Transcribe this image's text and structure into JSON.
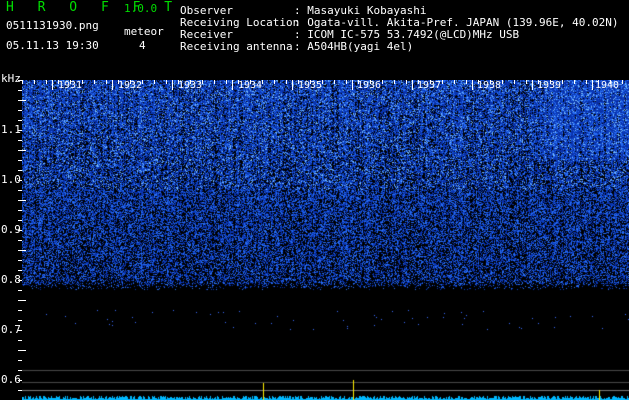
{
  "app": {
    "name": "H R O F F T",
    "version": "1.0.0"
  },
  "file": {
    "name": "0511131930.png",
    "datetime": "05.11.13 19:30"
  },
  "meteor": {
    "label": "meteor",
    "count": "4"
  },
  "station": {
    "observer": {
      "label": "Observer",
      "value": ": Masayuki Kobayashi"
    },
    "location": {
      "label": "Receiving Location",
      "value": ": Ogata-vill. Akita-Pref. JAPAN (139.96E, 40.02N)"
    },
    "receiver": {
      "label": "Receiver",
      "value": ": ICOM IC-575 53.7492(@LCD)MHz USB"
    },
    "antenna": {
      "label": "Receiving antenna",
      "value": ": A504HB(yagi 4el)"
    }
  },
  "spectrogram": {
    "unit_label": "kHz",
    "freq_labels": [
      "1.1",
      "1.0",
      "0.9",
      "0.8",
      "0.7",
      "0.6"
    ],
    "minute_labels": [
      "1931",
      "1932",
      "1933",
      "1934",
      "1935",
      "1936",
      "1937",
      "1938",
      "1939",
      "1940"
    ],
    "colors": {
      "background": "#000000",
      "noise_dark": "#0a1a8c",
      "noise_bright": "#4a8cff",
      "text": "#ffffff",
      "title": "#00dd00",
      "trace": "#00b8ff",
      "meteor_spike": "#ffee00"
    }
  }
}
